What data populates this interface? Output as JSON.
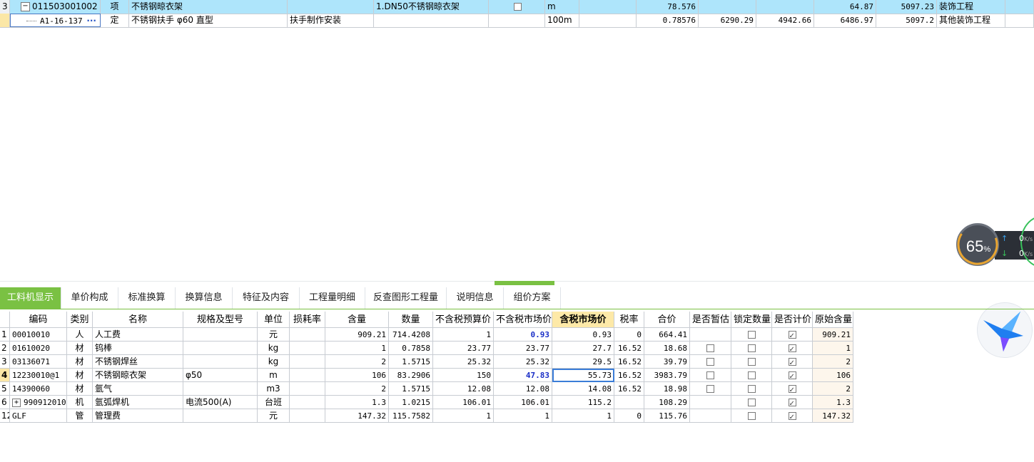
{
  "top_rows": [
    {
      "num": "3",
      "code": "011503001002",
      "type": "项",
      "name": "不锈钢晾衣架",
      "work": "",
      "feature": "1.DN50不锈钢晾衣架",
      "unit": "m",
      "qty": "78.576",
      "c1": "",
      "c2": "",
      "price": "64.87",
      "total": "5097.23",
      "category": "装饰工程"
    },
    {
      "num": "",
      "code": "A1-16-137",
      "type": "定",
      "name": "不锈钢扶手 φ60 直型",
      "work": "扶手制作安装",
      "feature": "",
      "unit": "100m",
      "qty": "0.78576",
      "c1": "6290.29",
      "c2": "4942.66",
      "price": "6486.97",
      "total": "5097.2",
      "category": "其他装饰工程"
    }
  ],
  "expander_symbol": "−",
  "more_symbol": "···",
  "speed_widget": {
    "percent": "65",
    "percent_sign": "%",
    "up": "0",
    "down": "0",
    "unit": "K/s",
    "up_arrow": "↑",
    "down_arrow": "↓"
  },
  "tabs": [
    "工料机显示",
    "单价构成",
    "标准换算",
    "换算信息",
    "特征及内容",
    "工程量明细",
    "反查图形工程量",
    "说明信息",
    "组价方案"
  ],
  "columns": [
    "编码",
    "类别",
    "名称",
    "规格及型号",
    "单位",
    "损耗率",
    "含量",
    "数量",
    "不含税预算价",
    "不含税市场价",
    "含税市场价",
    "税率",
    "合价",
    "是否暂估",
    "锁定数量",
    "是否计价",
    "原始含量"
  ],
  "rows": [
    {
      "num": "1",
      "code": "00010010",
      "cat": "人",
      "name": "人工费",
      "spec": "",
      "unit": "元",
      "loss": "",
      "content": "909.21",
      "qty": "714.4208",
      "pre": "1",
      "mkt": "0.93",
      "mkt_tax": "0.93",
      "rate": "0",
      "sum": "664.41",
      "est": null,
      "lock": false,
      "calc": true,
      "orig": "909.21"
    },
    {
      "num": "2",
      "code": "01610020",
      "cat": "材",
      "name": "钨棒",
      "spec": "",
      "unit": "kg",
      "loss": "",
      "content": "1",
      "qty": "0.7858",
      "pre": "23.77",
      "mkt": "23.77",
      "mkt_tax": "27.7",
      "rate": "16.52",
      "sum": "18.68",
      "est": false,
      "lock": false,
      "calc": true,
      "orig": "1"
    },
    {
      "num": "3",
      "code": "03136071",
      "cat": "材",
      "name": "不锈钢焊丝",
      "spec": "",
      "unit": "kg",
      "loss": "",
      "content": "2",
      "qty": "1.5715",
      "pre": "25.32",
      "mkt": "25.32",
      "mkt_tax": "29.5",
      "rate": "16.52",
      "sum": "39.79",
      "est": false,
      "lock": false,
      "calc": true,
      "orig": "2"
    },
    {
      "num": "4",
      "code": "12230010@1",
      "cat": "材",
      "name": "不锈钢晾衣架",
      "spec": "φ50",
      "unit": "m",
      "loss": "",
      "content": "106",
      "qty": "83.2906",
      "pre": "150",
      "mkt": "47.83",
      "mkt_tax": "55.73",
      "rate": "16.52",
      "sum": "3983.79",
      "est": false,
      "lock": false,
      "calc": true,
      "orig": "106"
    },
    {
      "num": "5",
      "code": "14390060",
      "cat": "材",
      "name": "氩气",
      "spec": "",
      "unit": "m3",
      "loss": "",
      "content": "2",
      "qty": "1.5715",
      "pre": "12.08",
      "mkt": "12.08",
      "mkt_tax": "14.08",
      "rate": "16.52",
      "sum": "18.98",
      "est": false,
      "lock": false,
      "calc": true,
      "orig": "2"
    },
    {
      "num": "6",
      "code": "990912010",
      "cat": "机",
      "name": "氩弧焊机",
      "spec": "电流500(A)",
      "unit": "台班",
      "loss": "",
      "content": "1.3",
      "qty": "1.0215",
      "pre": "106.01",
      "mkt": "106.01",
      "mkt_tax": "115.2",
      "rate": "",
      "sum": "108.29",
      "est": null,
      "lock": false,
      "calc": true,
      "orig": "1.3"
    },
    {
      "num": "12",
      "code": "GLF",
      "cat": "管",
      "name": "管理费",
      "spec": "",
      "unit": "元",
      "loss": "",
      "content": "147.32",
      "qty": "115.7582",
      "pre": "1",
      "mkt": "1",
      "mkt_tax": "1",
      "rate": "0",
      "sum": "115.76",
      "est": null,
      "lock": false,
      "calc": true,
      "orig": "147.32"
    }
  ],
  "colors": {
    "tab_active": "#7ac143",
    "selected_row": "#aee5fb",
    "highlight_header": "#fde9a8",
    "value_blue": "#1a2fc7"
  }
}
